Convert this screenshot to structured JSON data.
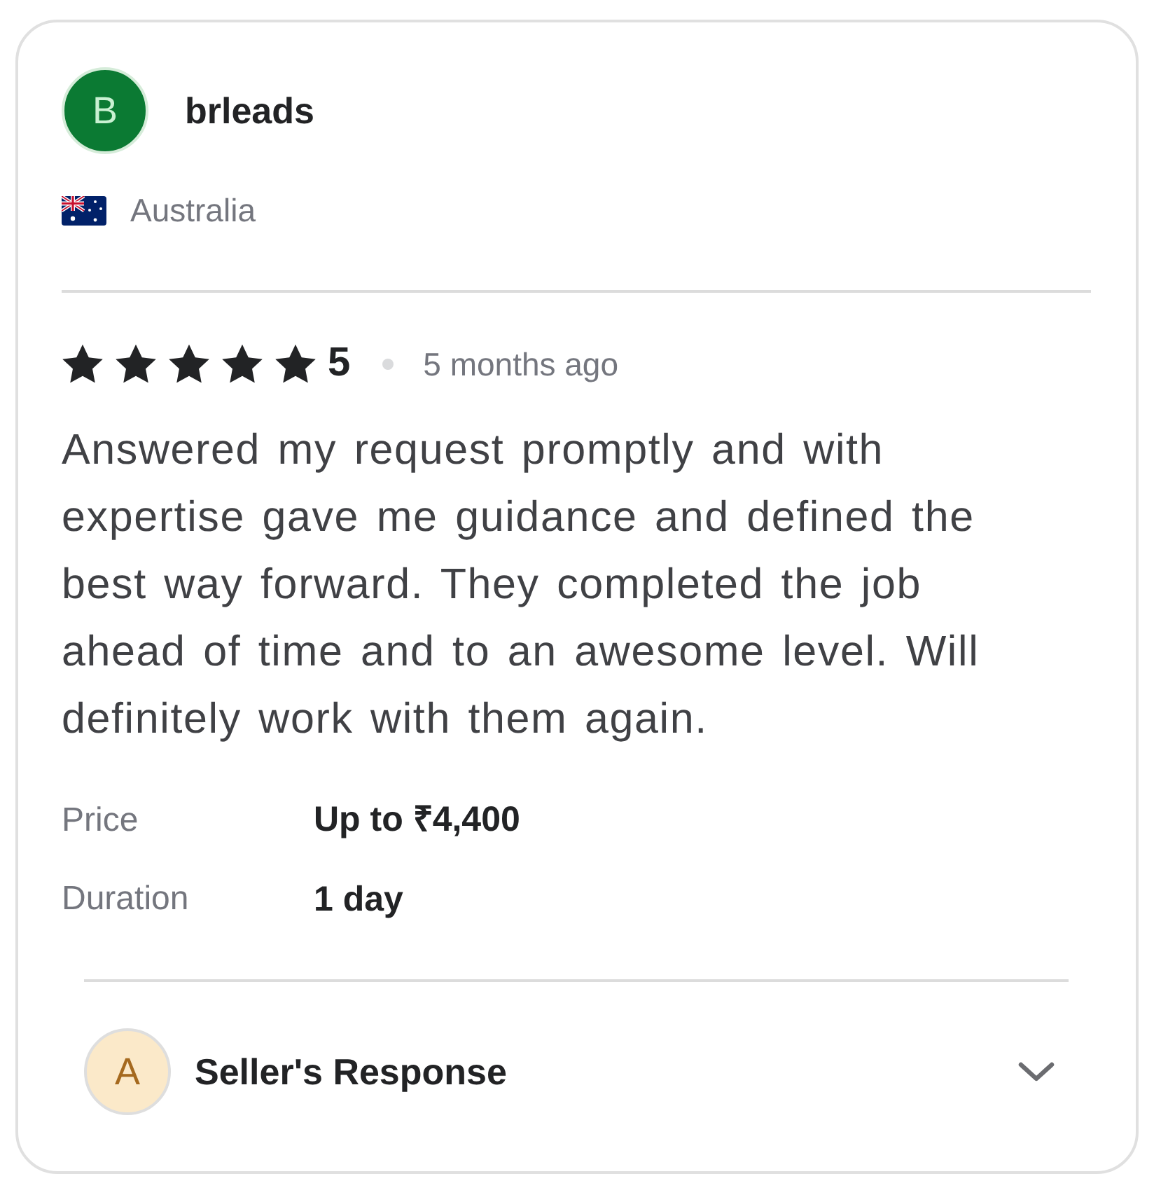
{
  "reviewer": {
    "avatar_letter": "B",
    "name": "brleads",
    "country": "Australia"
  },
  "rating": {
    "stars": 5,
    "score": "5",
    "time": "5 months ago"
  },
  "review_text": "Answered my request promptly and with expertise gave me guidance and defined the best way forward. They completed the job ahead of time and to an awesome level. Will definitely work with them again.",
  "details": [
    {
      "label": "Price",
      "value": "Up to ₹4,400"
    },
    {
      "label": "Duration",
      "value": "1 day"
    }
  ],
  "seller_response": {
    "avatar_letter": "A",
    "title": "Seller's Response",
    "expanded": false
  }
}
